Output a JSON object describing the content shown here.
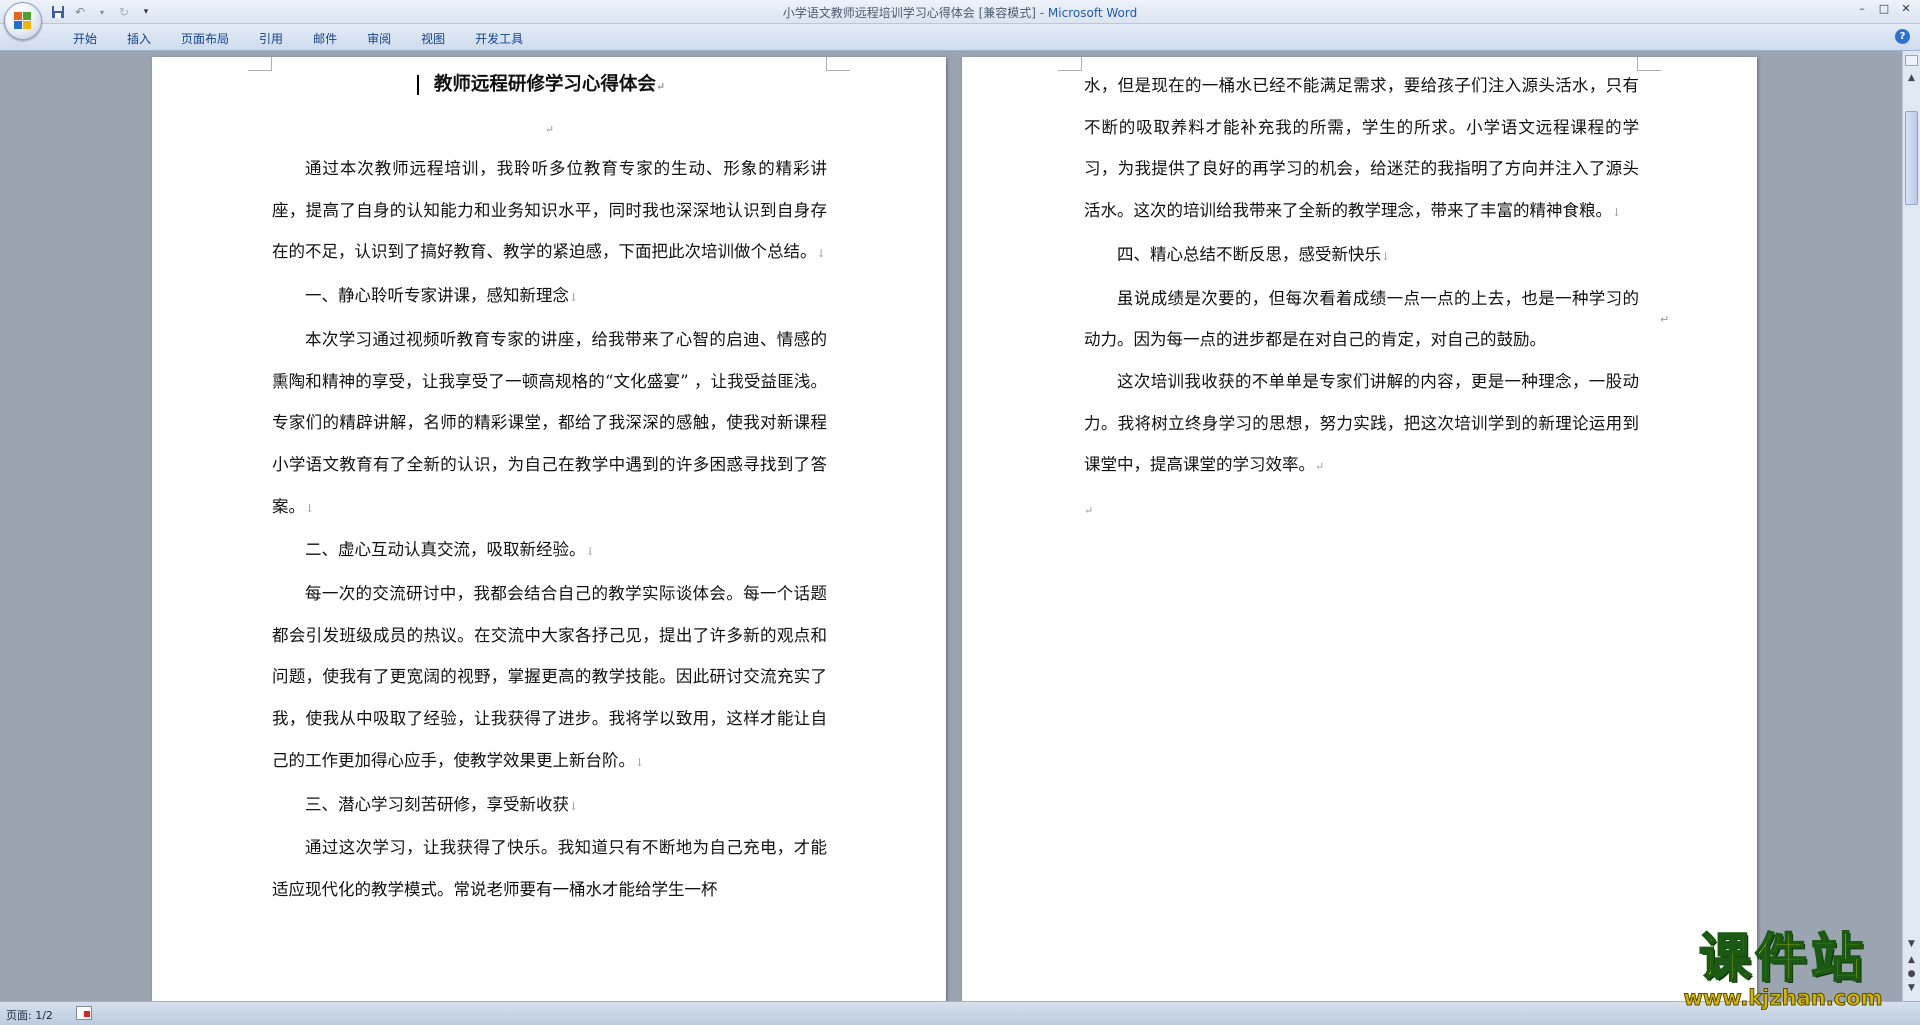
{
  "window": {
    "title": "小学语文教师远程培训学习心得体会 [兼容模式] - Microsoft Word",
    "title_doc": "小学语文教师远程培训学习心得体会 [兼容模式] - ",
    "title_app": "Microsoft Word",
    "controls": [
      "–",
      "□",
      "✕"
    ]
  },
  "ribbon": {
    "tabs": [
      "开始",
      "插入",
      "页面布局",
      "引用",
      "邮件",
      "审阅",
      "视图",
      "开发工具"
    ]
  },
  "document": {
    "title": "教师远程研修学习心得体会",
    "page1": [
      "通过本次教师远程培训，我聆听多位教育专家的生动、形象的精彩讲座，提高了自身的认知能力和业务知识水平，同时我也深深地认识到自身存在的不足，认识到了搞好教育、教学的紧迫感，下面把此次培训做个总结。",
      "一、静心聆听专家讲课，感知新理念",
      "本次学习通过视频听教育专家的讲座，给我带来了心智的启迪、情感的熏陶和精神的享受，让我享受了一顿高规格的“文化盛宴” ，让我受益匪浅。专家们的精辟讲解，名师的精彩课堂，都给了我深深的感触，使我对新课程小学语文教育有了全新的认识，为自己在教学中遇到的许多困惑寻找到了答案。",
      "二、虚心互动认真交流，吸取新经验。",
      "每一次的交流研讨中，我都会结合自己的教学实际谈体会。每一个话题都会引发班级成员的热议。在交流中大家各抒己见，提出了许多新的观点和问题，使我有了更宽阔的视野，掌握更高的教学技能。因此研讨交流充实了我，使我从中吸取了经验，让我获得了进步。我将学以致用，这样才能让自己的工作更加得心应手，使教学效果更上新台阶。",
      "三、潜心学习刻苦研修，享受新收获",
      "通过这次学习，让我获得了快乐。我知道只有不断地为自己充电，才能适应现代化的教学模式。常说老师要有一桶水才能给学生一杯"
    ],
    "page2": [
      "水，但是现在的一桶水已经不能满足需求，要给孩子们注入源头活水，只有不断的吸取养料才能补充我的所需，学生的所求。小学语文远程课程的学习，为我提供了良好的再学习的机会，给迷茫的我指明了方向并注入了源头活水。这次的培训给我带来了全新的教学理念，带来了丰富的精神食粮。",
      "四、精心总结不断反思，感受新快乐",
      "虽说成绩是次要的，但每次看着成绩一点一点的上去，也是一种学习的动力。因为每一点的进步都是在对自己的肯定，对自己的鼓励。",
      "这次培训我收获的不单单是专家们讲解的内容，更是一种理念，一股动力。我将树立终身学习的思想，努力实践，把这次培训学到的新理论运用到课堂中，提高课堂的学习效率。"
    ],
    "para_mark": "↵",
    "line_mark": "↓"
  },
  "status": {
    "page_count": "页面: 1/2"
  },
  "watermark": {
    "main": "课件站",
    "url": "www.kjzhan.com"
  },
  "colors": {
    "ribbon_text": "#15428b",
    "title_app": "#1f5ab5",
    "watermark_fill": "#ffe600"
  }
}
